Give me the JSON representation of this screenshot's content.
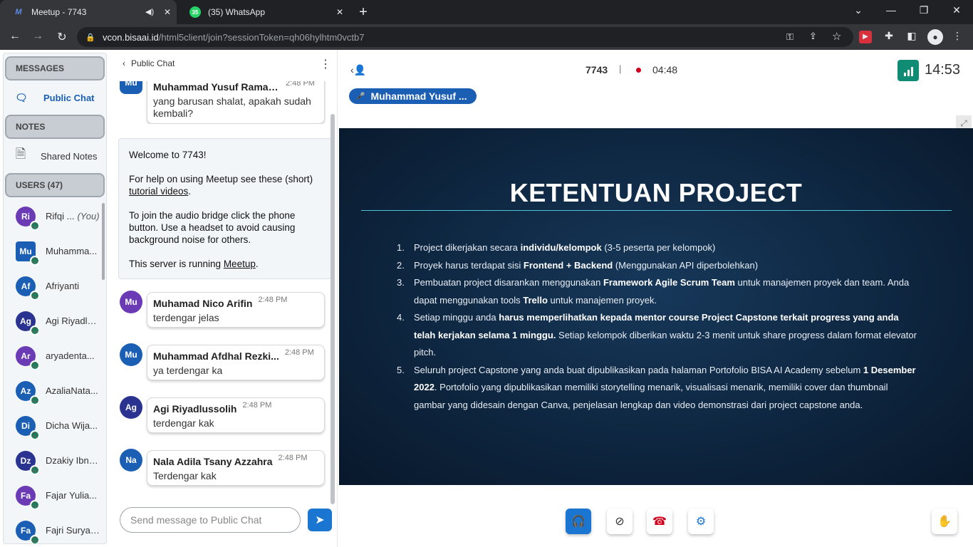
{
  "browser": {
    "tabs": [
      {
        "title": "Meetup - 7743",
        "icon": "meetup-icon",
        "audio": true,
        "active": true
      },
      {
        "title": "(35) WhatsApp",
        "icon": "whatsapp-icon",
        "badge": "35",
        "active": false
      }
    ],
    "url_host": "vcon.bisaai.id",
    "url_path": "/html5client/join?sessionToken=qh06hylhtm0vctb7"
  },
  "nav": {
    "messages_header": "MESSAGES",
    "public_chat": "Public Chat",
    "notes_header": "NOTES",
    "shared_notes": "Shared Notes",
    "users_header": "USERS (47)",
    "users": [
      {
        "initials": "Ri",
        "name": "Rifqi ...",
        "you": "(You)",
        "color": "#6a3bb5"
      },
      {
        "initials": "Mu",
        "name": "Muhamma...",
        "color": "#1b5fb5",
        "presenter": true
      },
      {
        "initials": "Af",
        "name": "Afriyanti",
        "color": "#1b5fb5"
      },
      {
        "initials": "Ag",
        "name": "Agi Riyadlu...",
        "color": "#2a3490"
      },
      {
        "initials": "Ar",
        "name": "aryadenta...",
        "color": "#6a3bb5"
      },
      {
        "initials": "Az",
        "name": "AzaliaNata...",
        "color": "#1b5fb5"
      },
      {
        "initials": "Di",
        "name": "Dicha Wija...",
        "color": "#1b5fb5"
      },
      {
        "initials": "Dz",
        "name": "Dzakiy Ibnu...",
        "color": "#2a3490"
      },
      {
        "initials": "Fa",
        "name": "Fajar Yulia...",
        "color": "#6a3bb5"
      },
      {
        "initials": "Fa",
        "name": "Fajri Surya ...",
        "color": "#1b5fb5"
      }
    ]
  },
  "chat": {
    "title": "Public Chat",
    "top_message": {
      "initials": "Mu",
      "sender": "Muhammad Yusuf Ramad...",
      "time": "2:48 PM",
      "text": "yang barusan shalat, apakah sudah kembali?"
    },
    "welcome": {
      "line1": "Welcome to 7743!",
      "line2a": "For help on using Meetup see these (short) ",
      "line2link": "tutorial videos",
      "line2b": ".",
      "line3": "To join the audio bridge click the phone button. Use a headset to avoid causing background noise for others.",
      "line4a": "This server is running ",
      "line4link": "Meetup",
      "line4b": "."
    },
    "messages": [
      {
        "initials": "Mu",
        "sender": "Muhamad Nico Arifin",
        "time": "2:48 PM",
        "text": "terdengar jelas",
        "color": "#6a3bb5"
      },
      {
        "initials": "Mu",
        "sender": "Muhammad Afdhal Rezki...",
        "time": "2:48 PM",
        "text": "ya terdengar ka",
        "color": "#1b5fb5"
      },
      {
        "initials": "Ag",
        "sender": "Agi Riyadlussolih",
        "time": "2:48 PM",
        "text": "terdengar kak",
        "color": "#2a3490"
      },
      {
        "initials": "Na",
        "sender": "Nala Adila Tsany Azzahra",
        "time": "2:48 PM",
        "text": "Terdengar kak",
        "color": "#1b5fb5"
      }
    ],
    "input_placeholder": "Send message to Public Chat"
  },
  "main": {
    "meeting_name": "7743",
    "separator": "|",
    "recording_time": "04:48",
    "clock": "14:53",
    "talking_user": "Muhammad Yusuf ...",
    "slide": {
      "title": "KETENTUAN PROJECT",
      "items": [
        {
          "n": "1.",
          "parts": [
            [
              "Project dikerjakan secara ",
              false
            ],
            [
              "individu/kelompok",
              true
            ],
            [
              " (3-5 peserta per kelompok)",
              false
            ]
          ]
        },
        {
          "n": "2.",
          "parts": [
            [
              "Proyek harus terdapat sisi ",
              false
            ],
            [
              "Frontend + Backend",
              true
            ],
            [
              " (Menggunakan API diperbolehkan)",
              false
            ]
          ]
        },
        {
          "n": "3.",
          "parts": [
            [
              "Pembuatan project disarankan menggunakan ",
              false
            ],
            [
              "Framework Agile Scrum Team",
              true
            ],
            [
              " untuk manajemen proyek dan team. Anda dapat menggunakan tools ",
              false
            ],
            [
              "Trello",
              true
            ],
            [
              " untuk manajemen proyek.",
              false
            ]
          ]
        },
        {
          "n": "4.",
          "parts": [
            [
              "Setiap minggu anda ",
              false
            ],
            [
              "harus memperlihatkan kepada mentor course Project Capstone terkait progress yang anda telah kerjakan selama 1 minggu.",
              true
            ],
            [
              " Setiap kelompok diberikan waktu 2-3 menit untuk share progress dalam format elevator pitch.",
              false
            ]
          ]
        },
        {
          "n": "5.",
          "parts": [
            [
              "Seluruh project Capstone yang anda buat dipublikasikan pada halaman Portofolio BISA AI Academy sebelum ",
              false
            ],
            [
              "1 Desember 2022",
              true
            ],
            [
              ". Portofolio yang dipublikasikan memiliki storytelling menarik, visualisasi menarik, memiliki cover dan thumbnail gambar yang didesain dengan Canva, penjelasan lengkap dan video demonstrasi dari project capstone anda.",
              false
            ]
          ]
        }
      ]
    }
  },
  "colors": {
    "primary": "#1b76d2",
    "danger": "#d3001c",
    "signal": "#0f8c73",
    "talker": "#1b5fb5"
  }
}
